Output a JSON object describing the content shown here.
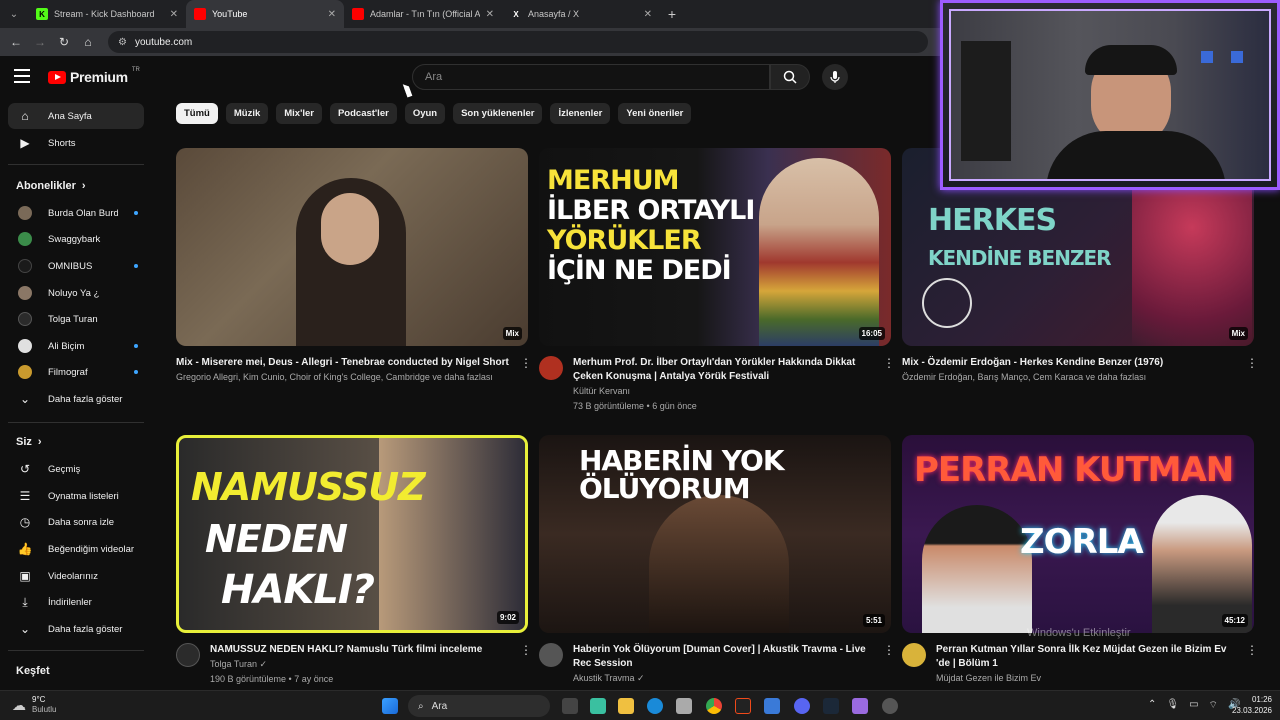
{
  "browser": {
    "tabs": [
      {
        "title": "Stream - Kick Dashboard",
        "favicon": "K",
        "favicon_color": "#53fc18"
      },
      {
        "title": "YouTube",
        "favicon": "",
        "favicon_color": "#ff0000"
      },
      {
        "title": "Adamlar - Tın Tın (Official Audi",
        "favicon": "",
        "favicon_color": "#ff0000"
      },
      {
        "title": "Anasayfa / X",
        "favicon": "X",
        "favicon_color": "#ffffff"
      }
    ],
    "url": "youtube.com"
  },
  "header": {
    "logo": "Premium",
    "logo_sup": "TR",
    "search_placeholder": "Ara"
  },
  "sidebar": {
    "main": [
      {
        "label": "Ana Sayfa",
        "icon": "home-icon"
      },
      {
        "label": "Shorts",
        "icon": "shorts-icon"
      }
    ],
    "subs_title": "Abonelikler",
    "subs": [
      {
        "label": "Burda Olan Burd...",
        "dot": true,
        "color": "#7a6a58"
      },
      {
        "label": "Swaggybark",
        "dot": false,
        "color": "#3b8c4a"
      },
      {
        "label": "OMNIBUS",
        "dot": true,
        "color": "#1a1a1a"
      },
      {
        "label": "Noluyo Ya ¿",
        "dot": false,
        "color": "#8a7766"
      },
      {
        "label": "Tolga Turan",
        "dot": false,
        "color": "#2b2b2b"
      },
      {
        "label": "Ali Biçim",
        "dot": true,
        "color": "#e0e0e0"
      },
      {
        "label": "Filmograf",
        "dot": true,
        "color": "#c99a2e"
      }
    ],
    "subs_more": "Daha fazla göster",
    "you_title": "Siz",
    "you": [
      {
        "label": "Geçmiş",
        "icon": "history-icon"
      },
      {
        "label": "Oynatma listeleri",
        "icon": "playlist-icon"
      },
      {
        "label": "Daha sonra izle",
        "icon": "clock-icon"
      },
      {
        "label": "Beğendiğim videolar",
        "icon": "thumbs-up-icon"
      },
      {
        "label": "Videolarınız",
        "icon": "video-icon"
      },
      {
        "label": "İndirilenler",
        "icon": "download-icon"
      }
    ],
    "you_more": "Daha fazla göster",
    "explore_title": "Keşfet"
  },
  "chips": [
    "Tümü",
    "Müzik",
    "Mix'ler",
    "Podcast'ler",
    "Oyun",
    "Son yüklenenler",
    "İzlenenler",
    "Yeni öneriler"
  ],
  "videos": [
    {
      "title": "Mix - Miserere mei, Deus - Allegri - Tenebrae conducted by Nigel Short",
      "line2": "",
      "sub1": "Gregorio Allegri, Kim Cunio, Choir of King's College, Cambridge ve daha fazlası",
      "sub2": "",
      "badge": "Mix",
      "thumb_bg": "linear-gradient(135deg,#5a4a3a,#7a6a55 40%,#4a3c30)",
      "thumb_text": "",
      "avatar": ""
    },
    {
      "title": "Merhum Prof. Dr. İlber Ortaylı'dan Yörükler Hakkında Dikkat",
      "line2": "Çeken Konuşma |  Antalya Yörük Festivali",
      "sub1": "Kültür Kervanı",
      "sub2": "73 B görüntüleme • 6 gün önce",
      "badge": "16:05",
      "thumb_bg": "linear-gradient(90deg,#111 0%,#1a1a1a 45%,#3a3050 65%,#7a2a2a 100%)",
      "thumb_text": "MERHUM\nİLBER ORTAYLI\nYÖRÜKLER\nİÇİN NE DEDİ",
      "avatar": "#b03020"
    },
    {
      "title": "Mix - Özdemir Erdoğan - Herkes Kendine Benzer (1976)",
      "line2": "",
      "sub1": "Özdemir Erdoğan, Barış Manço, Cem Karaca ve daha fazlası",
      "sub2": "",
      "badge": "Mix",
      "thumb_bg": "linear-gradient(135deg,#1a1f2e,#2d1f35 50%,#4a1a2a)",
      "thumb_text": "HERKES\nKENDİNE BENZER",
      "avatar": ""
    },
    {
      "title": "NAMUSSUZ NEDEN HAKLI? Namuslu Türk filmi inceleme",
      "line2": "",
      "sub1": "Tolga Turan",
      "sub2": "190 B görüntüleme • 7 ay önce",
      "badge": "9:02",
      "thumb_bg": "linear-gradient(90deg,#2a2a2a,#5a5046 60%,#3a3a44)",
      "thumb_text": "NAMUSSUZ\nNEDEN\nHAKLI?",
      "avatar": "#2b2b2b"
    },
    {
      "title": "Haberin Yok Ölüyorum [Duman Cover] | Akustik Travma - Live",
      "line2": "Rec Session",
      "sub1": "Akustik Travma",
      "sub2": "",
      "badge": "5:51",
      "thumb_bg": "linear-gradient(180deg,#1a1412,#3a2a22 50%,#1c1512)",
      "thumb_text": "HABERİN YOK ÖLÜYORUM",
      "avatar": "#555"
    },
    {
      "title": "Perran Kutman Yıllar Sonra İlk Kez Müjdat Gezen ile Bizim Ev",
      "line2": "'de | Bölüm 1",
      "sub1": "Müjdat Gezen ile Bizim Ev",
      "sub2": "",
      "badge": "45:12",
      "thumb_bg": "linear-gradient(180deg,#2a0f3a,#3a1850 50%,#2a1240)",
      "thumb_text": "PERRAN KUTMAN",
      "avatar": "#d9b33a"
    }
  ],
  "taskbar": {
    "weather_temp": "9°C",
    "weather_desc": "Bulutlu",
    "search": "Ara",
    "time": "01:26",
    "date": "23.03.2026"
  },
  "watermark": "Windows'u Etkinleştir"
}
